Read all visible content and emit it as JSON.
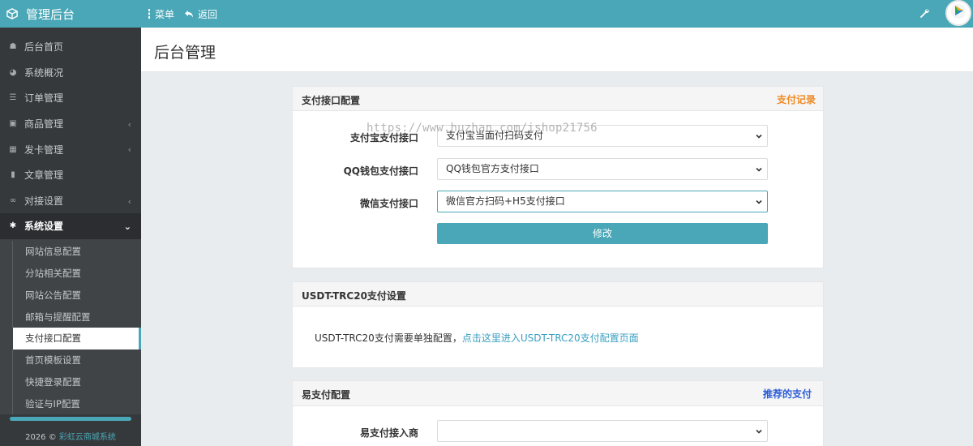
{
  "header": {
    "app_title": "管理后台",
    "menu_label": "菜单",
    "back_label": "返回"
  },
  "sidebar": {
    "items": [
      {
        "label": "后台首页",
        "icon": "home-icon"
      },
      {
        "label": "系统概况",
        "icon": "dashboard-icon"
      },
      {
        "label": "订单管理",
        "icon": "list-icon"
      },
      {
        "label": "商品管理",
        "icon": "cart-icon",
        "has_children": true
      },
      {
        "label": "发卡管理",
        "icon": "grid-icon",
        "has_children": true
      },
      {
        "label": "文章管理",
        "icon": "book-icon"
      },
      {
        "label": "对接设置",
        "icon": "connect-icon",
        "has_children": true
      },
      {
        "label": "系统设置",
        "icon": "gear-icon",
        "expanded": true
      }
    ],
    "sub_items": [
      {
        "label": "网站信息配置"
      },
      {
        "label": "分站相关配置"
      },
      {
        "label": "网站公告配置"
      },
      {
        "label": "邮箱与提醒配置"
      },
      {
        "label": "支付接口配置",
        "current": true
      },
      {
        "label": "首页模板设置"
      },
      {
        "label": "快捷登录配置"
      },
      {
        "label": "验证与IP配置"
      }
    ],
    "footer": {
      "year": "2026 ©",
      "system_name": "彩虹云商城系统"
    }
  },
  "page": {
    "title": "后台管理"
  },
  "payment_panel": {
    "title": "支付接口配置",
    "link": "支付记录",
    "watermark": "https://www.huzhan.com/ishop21756",
    "fields": [
      {
        "label": "支付宝支付接口",
        "value": "支付宝当面付扫码支付"
      },
      {
        "label": "QQ钱包支付接口",
        "value": "QQ钱包官方支付接口"
      },
      {
        "label": "微信支付接口",
        "value": "微信官方扫码+H5支付接口"
      }
    ],
    "submit_label": "修改"
  },
  "usdt_panel": {
    "title": "USDT-TRC20支付设置",
    "text": "USDT-TRC20支付需要单独配置，",
    "link_text": "点击这里进入USDT-TRC20支付配置页面"
  },
  "epay_panel": {
    "title": "易支付配置",
    "link": "推荐的支付",
    "fields": [
      {
        "label": "易支付接入商",
        "value": ""
      }
    ]
  },
  "colors": {
    "topbar": "#4aa7b7",
    "sidebar": "#36393c",
    "link_orange": "#f08a24",
    "link_blue": "#2a5bd7",
    "usdt_link": "#3a9fc0"
  }
}
